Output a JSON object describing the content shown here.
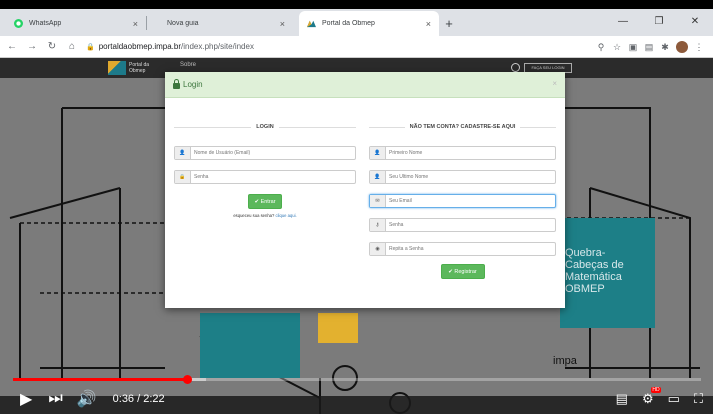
{
  "browser": {
    "tabs": [
      {
        "title": "WhatsApp",
        "icon": "whatsapp-icon",
        "color": "#25d366",
        "active": false
      },
      {
        "title": "Nova guia",
        "icon": "",
        "color": "",
        "active": false
      },
      {
        "title": "Portal da Obmep",
        "icon": "obmep-icon",
        "color": "#1d7a8a",
        "active": true
      }
    ],
    "tab_close": "×",
    "new_tab": "+",
    "win_min": "—",
    "win_max": "❐",
    "win_close": "✕",
    "url_domain": "portaldaobmep.impa.br",
    "url_path": "/index.php/site/index"
  },
  "site": {
    "logo_text_line1": "Portal da",
    "logo_text_line2": "Obmep",
    "nav_sobre": "Sobre",
    "header_button": "FAÇA SEU LOGIN"
  },
  "modal": {
    "title": "Login",
    "close": "×",
    "login": {
      "section_title": "LOGIN",
      "username_placeholder": "Nome de Usuário (Email)",
      "password_placeholder": "Senha",
      "submit_label": "Entrar",
      "forgot_text": "esqueceu sua senha?",
      "forgot_link": "clique aqui."
    },
    "register": {
      "section_title": "NÃO TEM CONTA? CADASTRE-SE AQUI",
      "first_name_placeholder": "Primeiro Nome",
      "last_name_placeholder": "Seu Último Nome",
      "email_placeholder": "Seu Email",
      "password_placeholder": "Senha",
      "repeat_password_placeholder": "Repita a Senha",
      "submit_label": "Registrar"
    }
  },
  "background": {
    "puzzle_line1": "Quebra-",
    "puzzle_line2": "Cabeças de",
    "puzzle_line3": "Matemática",
    "puzzle_line4": "OBMEP",
    "impa_text": "impa"
  },
  "player": {
    "current_time": "0:36",
    "duration": "2:22",
    "time_separator": " / ",
    "played_fraction": 0.253,
    "loaded_fraction": 0.28
  },
  "colors": {
    "accent_green": "#5cb85c",
    "progress_red": "#ff0000"
  }
}
